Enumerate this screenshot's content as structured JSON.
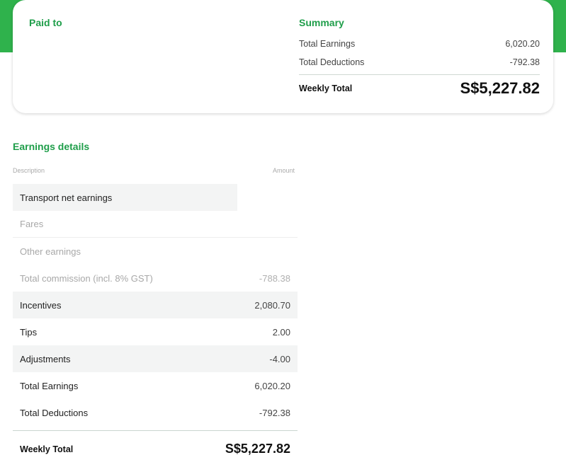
{
  "header": {
    "paid_to_label": "Paid to"
  },
  "summary": {
    "title": "Summary",
    "rows": [
      {
        "label": "Total Earnings",
        "value": "6,020.20"
      },
      {
        "label": "Total Deductions",
        "value": "-792.38"
      }
    ],
    "total_label": "Weekly Total",
    "total_value": "S$5,227.82"
  },
  "earnings": {
    "title": "Earnings details",
    "col_description": "Description",
    "col_amount": "Amount",
    "rows": [
      {
        "label": "Transport net earnings",
        "value": ""
      },
      {
        "label": "Fares",
        "value": ""
      },
      {
        "label": "Other earnings",
        "value": ""
      },
      {
        "label": "Total commission (incl. 8% GST)",
        "value": "-788.38"
      },
      {
        "label": "Incentives",
        "value": "2,080.70"
      },
      {
        "label": "Tips",
        "value": "2.00"
      },
      {
        "label": "Adjustments",
        "value": "-4.00"
      },
      {
        "label": "Total Earnings",
        "value": "6,020.20"
      },
      {
        "label": "Total Deductions",
        "value": "-792.38"
      }
    ],
    "total_label": "Weekly Total",
    "total_value": "S$5,227.82"
  },
  "colors": {
    "brand_green": "#2fb24c",
    "heading_green": "#1f9e4a"
  }
}
